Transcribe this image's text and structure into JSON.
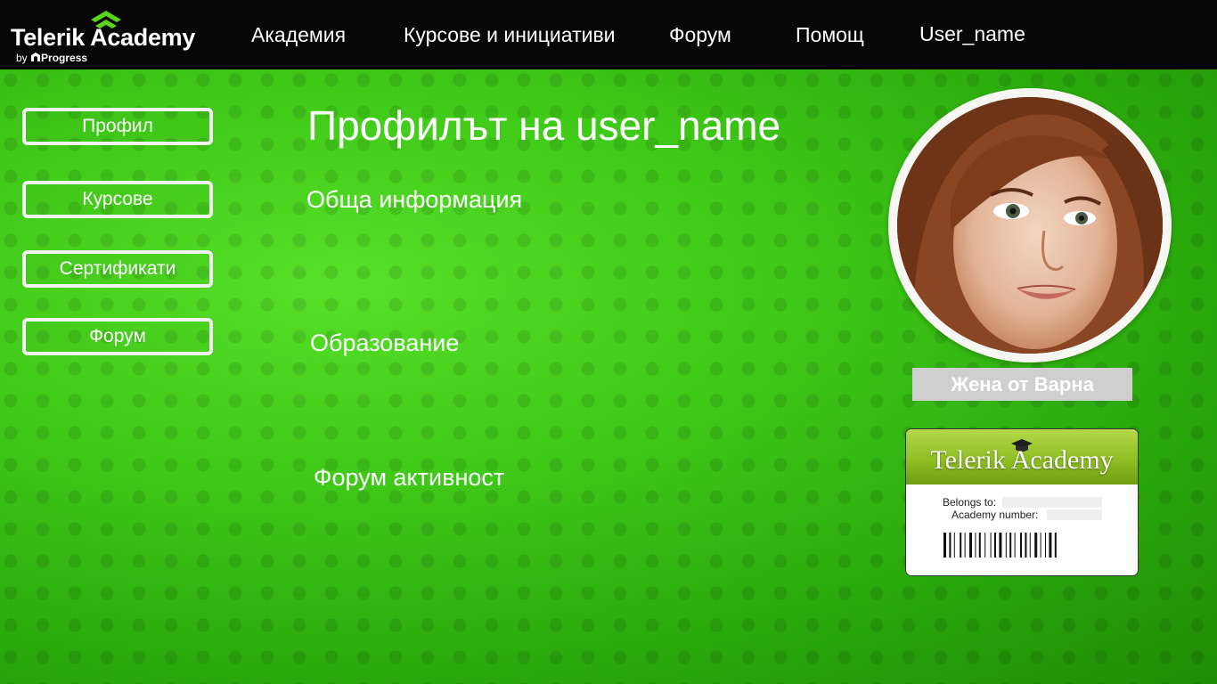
{
  "header": {
    "logo_title": "Telerik Academy",
    "logo_by": "by",
    "logo_progress": "Progress",
    "nav": [
      {
        "label": "Академия"
      },
      {
        "label": "Курсове и инициативи"
      },
      {
        "label": "Форум"
      },
      {
        "label": "Помощ"
      },
      {
        "label": "User_name"
      }
    ]
  },
  "sidebar": {
    "items": [
      {
        "label": "Профил"
      },
      {
        "label": "Курсове"
      },
      {
        "label": "Сертификати"
      },
      {
        "label": "Форум"
      }
    ]
  },
  "main": {
    "title": "Профилът на user_name",
    "sections": [
      {
        "label": "Обща информация"
      },
      {
        "label": "Образование"
      },
      {
        "label": "Форум активност"
      }
    ]
  },
  "profile": {
    "caption": "Жена от Варна"
  },
  "card": {
    "title": "Telerik Academy",
    "belongs_to": "Belongs to:",
    "academy_number": "Academy number:"
  },
  "colors": {
    "topbar": "#060606",
    "background": "#2fb80e",
    "logo_accent": "#5ad41a",
    "text": "#ffffff"
  },
  "icons": [
    "logo-chevron-icon",
    "progress-logo-icon",
    "graduation-cap-icon",
    "barcode-icon"
  ]
}
